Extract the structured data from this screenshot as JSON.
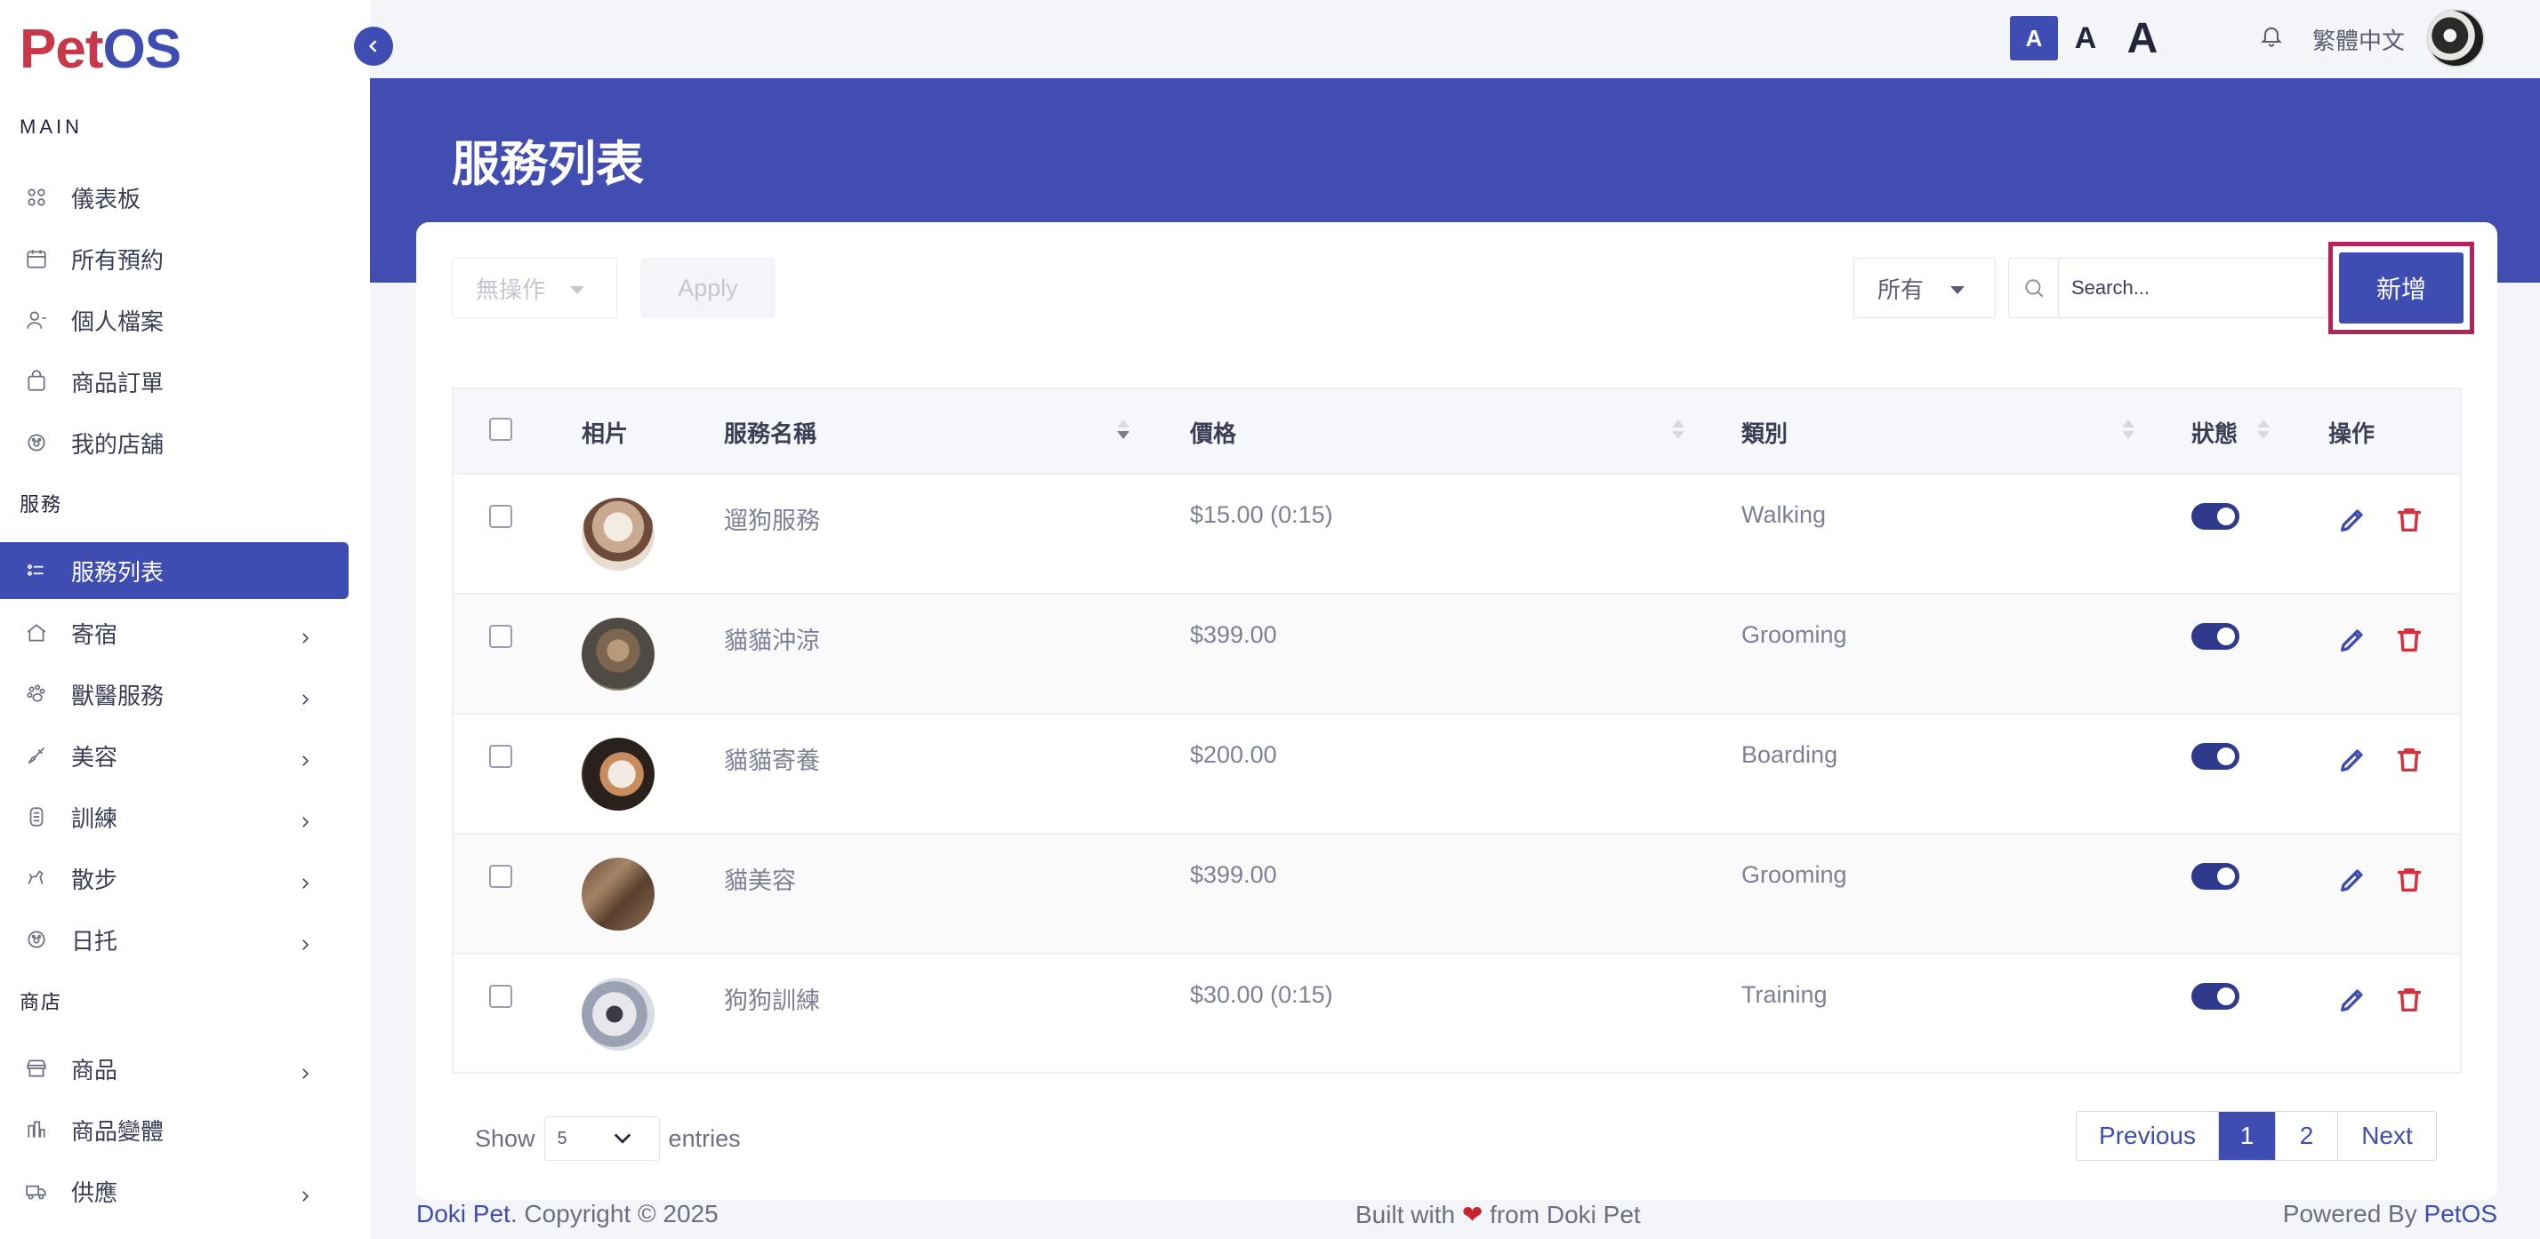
{
  "brand": {
    "logo_part1": "Pet",
    "logo_part2": "OS"
  },
  "sidebar": {
    "section_main": "MAIN",
    "main_items": [
      {
        "label": "儀表板",
        "icon": "dashboard-icon"
      },
      {
        "label": "所有預約",
        "icon": "calendar-icon"
      },
      {
        "label": "個人檔案",
        "icon": "user-icon"
      },
      {
        "label": "商品訂單",
        "icon": "shopping-bag-icon"
      },
      {
        "label": "我的店舖",
        "icon": "paw-settings-icon"
      }
    ],
    "section_services": "服務",
    "service_items": [
      {
        "label": "服務列表",
        "icon": "list-icon",
        "active": true
      },
      {
        "label": "寄宿",
        "icon": "house-icon"
      },
      {
        "label": "獸醫服務",
        "icon": "paws-icon"
      },
      {
        "label": "美容",
        "icon": "brush-icon"
      },
      {
        "label": "訓練",
        "icon": "medal-icon"
      },
      {
        "label": "散步",
        "icon": "dog-walk-icon"
      },
      {
        "label": "日托",
        "icon": "paw-sun-icon"
      }
    ],
    "section_shop": "商店",
    "shop_items": [
      {
        "label": "商品",
        "icon": "store-icon"
      },
      {
        "label": "商品變體",
        "icon": "variants-icon"
      },
      {
        "label": "供應",
        "icon": "truck-icon"
      }
    ]
  },
  "topbar": {
    "font_small": "A",
    "font_mid": "A",
    "font_big": "A",
    "language": "繁體中文"
  },
  "page": {
    "title": "服務列表"
  },
  "toolbar": {
    "bulk_action": "無操作",
    "apply": "Apply",
    "filter": "所有",
    "search_placeholder": "Search...",
    "add": "新增"
  },
  "table": {
    "headers": {
      "photo": "相片",
      "name": "服務名稱",
      "price": "價格",
      "category": "類別",
      "status": "狀態",
      "actions": "操作"
    },
    "rows": [
      {
        "name": "遛狗服務",
        "price": "$15.00 (0:15)",
        "category": "Walking",
        "status_on": true
      },
      {
        "name": "貓貓沖涼",
        "price": "$399.00",
        "category": "Grooming",
        "status_on": true
      },
      {
        "name": "貓貓寄養",
        "price": "$200.00",
        "category": "Boarding",
        "status_on": true
      },
      {
        "name": "貓美容",
        "price": "$399.00",
        "category": "Grooming",
        "status_on": true
      },
      {
        "name": "狗狗訓練",
        "price": "$30.00 (0:15)",
        "category": "Training",
        "status_on": true
      }
    ]
  },
  "pagination": {
    "show": "Show",
    "page_size": "5",
    "entries": "entries",
    "previous": "Previous",
    "pages": [
      "1",
      "2"
    ],
    "current": "1",
    "next": "Next"
  },
  "footer": {
    "left_brand": "Doki Pet",
    "left_text": ". Copyright © 2025",
    "center_pre": "Built with",
    "center_post": "from Doki Pet",
    "right_pre": "Powered By",
    "right_brand": "PetOS"
  },
  "colors": {
    "accent": "#3f4db3",
    "danger": "#d6303c",
    "brand_red": "#c8374a",
    "highlight": "#b3245a"
  }
}
